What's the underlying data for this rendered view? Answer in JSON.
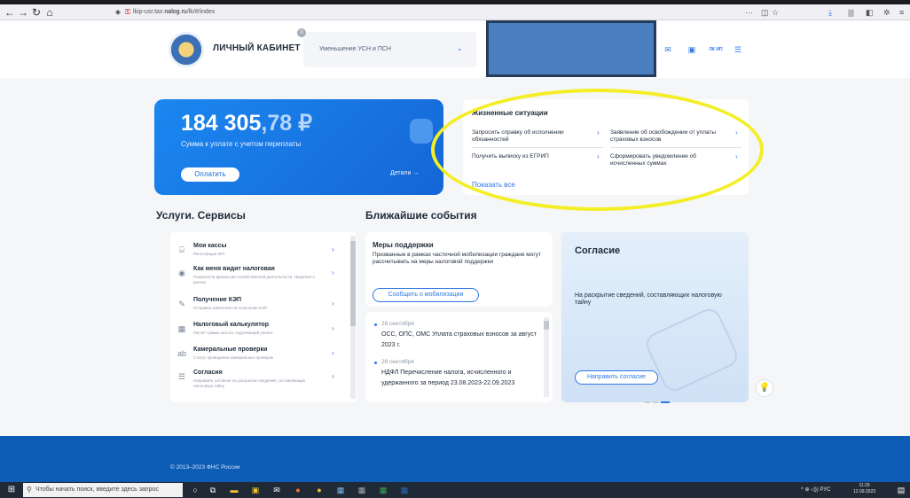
{
  "browser": {
    "url_prefix": "lkip-usr.tax.",
    "url_domain": "nalog.ru",
    "url_suffix": "/lk/#/index",
    "more_icon": "···"
  },
  "header": {
    "brand": "ЛИЧНЫЙ КАБИНЕТ ИП",
    "select_badge": "0",
    "select_value": "Уменьшение УСН и ПСН",
    "user_initials": "ЛК ИП"
  },
  "balance": {
    "amount_main": "184 305",
    "amount_cents": ",78 ₽",
    "subtitle": "Сумма к уплате с учетом переплаты",
    "pay_button": "Оплатить",
    "details_link": "Детали →"
  },
  "situations": {
    "title": "Жизненные ситуации",
    "items": [
      "Запросить справку об исполнении обязанностей",
      "Заявление об освобождении от уплаты страховых взносов",
      "Получить выписку из ЕГРИП",
      "Сформировать уведомление об исчисленных суммах"
    ],
    "show_all": "Показать все"
  },
  "sections": {
    "services": "Услуги. Сервисы",
    "events": "Ближайшие события"
  },
  "services": [
    {
      "title": "Мои кассы",
      "sub": "Регистрация ККТ",
      "icon": "cash-register-icon"
    },
    {
      "title": "Как меня видит налоговая",
      "sub": "Показатели финансово-хозяйственной деятельности, сведения о рисках",
      "icon": "eye-search-icon"
    },
    {
      "title": "Получение КЭП",
      "sub": "Отправка заявления на получение КЭП",
      "icon": "signature-icon"
    },
    {
      "title": "Налоговый калькулятор",
      "sub": "Расчет суммы налога, подлежащей уплате",
      "icon": "calculator-icon"
    },
    {
      "title": "Камеральные проверки",
      "sub": "Статус проведения камеральных проверок",
      "icon": "abc-icon"
    },
    {
      "title": "Согласия",
      "sub": "Направить согласие на раскрытие сведений, составляющих налоговую тайну",
      "icon": "list-icon"
    }
  ],
  "support": {
    "title": "Меры поддержки",
    "text": "Призванные в рамках частичной мобилизации граждане могут рассчитывать на меры налоговой поддержки",
    "button": "Сообщить о мобилизации"
  },
  "events": [
    {
      "date": "28 сентября",
      "text": "ОСС, ОПС, ОМС Уплата страховых взносов за август 2023 г."
    },
    {
      "date": "28 сентября",
      "text": "НДФЛ Перечисление налога, исчисленного и удержанного за период 23.08.2023-22.09.2023"
    }
  ],
  "consent": {
    "title": "Согласие",
    "text": "На раскрытие сведений, составляющих налоговую тайну",
    "button": "Направить согласие"
  },
  "footer": {
    "copyright": "© 2013–2023 ФНС России"
  },
  "taskbar": {
    "search_placeholder": "Чтобы начать поиск, введите здесь запрос",
    "tray_text": "^ ⊕ ◁)) РУС",
    "time": "11:29",
    "date": "12.09.2023"
  },
  "colors": {
    "accent": "#2e78e6",
    "balance_card": "#1b87f0",
    "footer": "#0d5cb6",
    "highlight_ellipse": "#f4ee26",
    "redaction": "#4a80c2"
  }
}
